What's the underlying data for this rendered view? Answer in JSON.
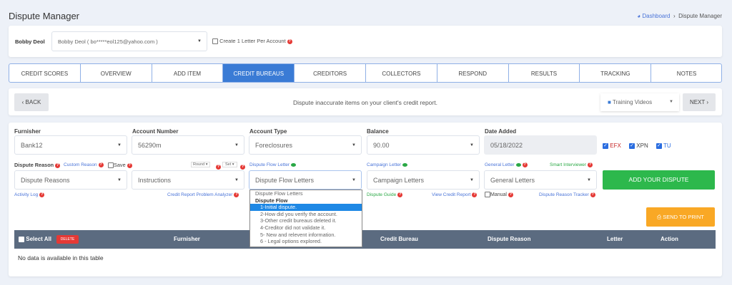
{
  "header": {
    "title": "Dispute Manager",
    "breadcrumb": {
      "home": "Dashboard",
      "current": "Dispute Manager"
    }
  },
  "client": {
    "label": "Bobby Deol",
    "select_value": "Bobby Deol ( bo*****eol125@yahoo.com )",
    "one_letter_label": "Create 1 Letter Per Account"
  },
  "tabs": [
    {
      "label": "CREDIT SCORES"
    },
    {
      "label": "OVERVIEW"
    },
    {
      "label": "ADD ITEM"
    },
    {
      "label": "CREDIT BUREAUS",
      "active": true
    },
    {
      "label": "CREDITORS"
    },
    {
      "label": "COLLECTORS"
    },
    {
      "label": "RESPOND"
    },
    {
      "label": "RESULTS"
    },
    {
      "label": "TRACKING"
    },
    {
      "label": "NOTES"
    }
  ],
  "nav": {
    "back": "BACK",
    "message": "Dispute inaccurate items on your client's credit report.",
    "training": "Training Videos",
    "next": "NEXT"
  },
  "form": {
    "furnisher": {
      "label": "Furnisher",
      "value": "Bank12"
    },
    "account_number": {
      "label": "Account Number",
      "value": "56290m"
    },
    "account_type": {
      "label": "Account Type",
      "value": "Foreclosures"
    },
    "balance": {
      "label": "Balance",
      "value": "90.00"
    },
    "date_added": {
      "label": "Date Added",
      "value": "05/18/2022"
    },
    "bureaus": [
      {
        "label": "EFX",
        "checked": true,
        "color": "#c62828"
      },
      {
        "label": "XPN",
        "checked": true,
        "color": "#444444"
      },
      {
        "label": "TU",
        "checked": true,
        "color": "#2a6de0"
      }
    ],
    "dispute_reason_label": "Dispute Reason",
    "custom_reason": "Custom Reason",
    "save": "Save",
    "round": "Round",
    "set": "Set",
    "dispute_flow_letter": "Dispute Flow Letter",
    "campaign_letter": "Campaign Letter",
    "general_letter": "General Letter",
    "smart_interviewer": "Smart Interviewer",
    "dispute_reasons": "Dispute Reasons",
    "instructions": "Instructions",
    "dispute_flow_letters": "Dispute Flow Letters",
    "campaign_letters": "Campaign Letters",
    "general_letters": "General Letters",
    "add_dispute": "ADD YOUR DISPUTE",
    "activity_log": "Activity Log",
    "analyzer": "Credit Report Problem Analyzer",
    "dispute_guide": "Dispute Guide",
    "view_report": "View Credit Report",
    "manual": "Manual",
    "reason_tracker": "Dispute Reason Tracker"
  },
  "dropdown": {
    "placeholder": "Dispute Flow Letters",
    "group": "Dispute Flow",
    "options": [
      "1-Initial dispute.",
      "2-How did you verify the account.",
      "3-Other credit bureaus deleted it.",
      "4-Creditor did not validate it.",
      "5- New and relevent information.",
      "6 - Legal options explored."
    ],
    "selected": 0
  },
  "send_to_print": "SEND TO PRINT",
  "table": {
    "select_all": "Select All",
    "delete": "DELETE",
    "columns": [
      "Furnisher",
      "Credit Bureau",
      "Dispute Reason",
      "Letter",
      "Action"
    ],
    "empty": "No data is available in this table"
  },
  "colors": {
    "accent": "#3a7bd5",
    "green": "#2db84c",
    "orange": "#f9a825",
    "table_header": "#5b6b80"
  }
}
